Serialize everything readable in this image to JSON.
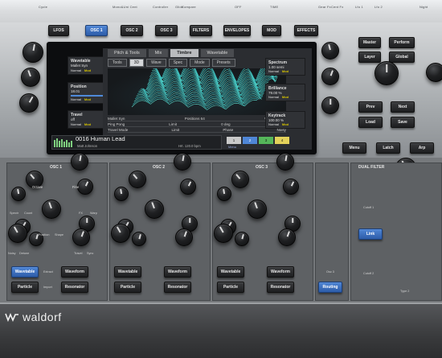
{
  "top_legend": [
    "Cycle",
    "Mono&Uni Cent",
    "Controller",
    "Glide",
    "Compare",
    "OFF",
    "TIME",
    "Gear Fx",
    "Cent Fx",
    "Lfo 1",
    "Lfo 2",
    "Night",
    "Gate"
  ],
  "section_buttons": [
    "LFOS",
    "OSC 1",
    "OSC 2",
    "OSC 3",
    "FILTERS",
    "ENVELOPES",
    "MOD",
    "EFFECTS"
  ],
  "active_section": "OSC 1",
  "screen": {
    "tabs": [
      "Pitch & Tools",
      "Mix",
      "Timbre",
      "Wavetable"
    ],
    "active_tab": "Timbre",
    "subtabs": [
      "Tools",
      "3D",
      "Wave",
      "Spec",
      "Mode",
      "Presets"
    ],
    "active_subtab": "3D",
    "wave_info": {
      "name": "Mallet Syn",
      "positions": "Positions 64",
      "waveten": "Waveten 128"
    },
    "params": [
      [
        "Ping Pong",
        "Limit",
        "0 deg",
        "0.00 %"
      ],
      [
        "Travel Mode",
        "Limit",
        "Phase",
        "Noisy"
      ]
    ],
    "preset_name": "0016 Human Lead",
    "preset_author": "Matt Johnson",
    "preset_bpm": "Hrt. 120.0 bpm",
    "menu_label": "Menu",
    "select_numbers": [
      "1",
      "2",
      "3",
      "4"
    ]
  },
  "left_boxes": [
    {
      "title": "Wavetable",
      "value": "Mallet Syn",
      "mods": [
        "Normal",
        "Mod"
      ]
    },
    {
      "title": "Position",
      "value": "18.01",
      "mods": [
        "Normal",
        "Mod"
      ]
    },
    {
      "title": "Travel",
      "value": "off",
      "mods": [
        "Normal",
        "Mod"
      ]
    }
  ],
  "right_boxes": [
    {
      "title": "Spectrum",
      "value": "1.00 semi",
      "mods": [
        "Normal",
        "Mod"
      ]
    },
    {
      "title": "Brilliance",
      "value": "79.00 %",
      "mods": [
        "Normal",
        "Mod"
      ]
    },
    {
      "title": "Keytrack",
      "value": "100.00 %",
      "mods": [
        "Normal",
        "Mod"
      ]
    }
  ],
  "right_buttons": [
    "Master",
    "Perform",
    "Layer",
    "Global",
    "Prev",
    "Next",
    "Load",
    "Save"
  ],
  "bottom_buttons": [
    "Menu",
    "Latch",
    "Arp"
  ],
  "osc_panels": [
    {
      "title": "OSC 1"
    },
    {
      "title": "OSC 2"
    },
    {
      "title": "OSC 3"
    }
  ],
  "osc_labels": {
    "octave": "Octave",
    "fine": "Fine",
    "spectr": "Spectr",
    "count": "Count",
    "fx": "FX",
    "warp": "Warp",
    "position": "Position",
    "shape": "Shape",
    "timbre": "Timbre",
    "noisy": "Noisy",
    "detune": "Detune",
    "spread": "Spread",
    "travel": "Travel",
    "sync": "Sync",
    "wavetable_btn": "Wavetable",
    "waveform_btn": "Waveform",
    "particle_btn": "Particle",
    "resonator_btn": "Resonator",
    "extract": "Extract",
    "import": "Import"
  },
  "disc": {
    "label": "Osc 3",
    "routing": "Routing"
  },
  "filter": {
    "title": "DUAL FILTER",
    "cutoff1": "Cutoff 1",
    "cutoff2": "Cutoff 2",
    "link": "Link",
    "type2": "Type 2"
  },
  "brand": "waldorf",
  "colors": {
    "accent_blue": "#4f86d6",
    "mod_yellow": "#d6c300",
    "body_dark": "#1f2022"
  }
}
